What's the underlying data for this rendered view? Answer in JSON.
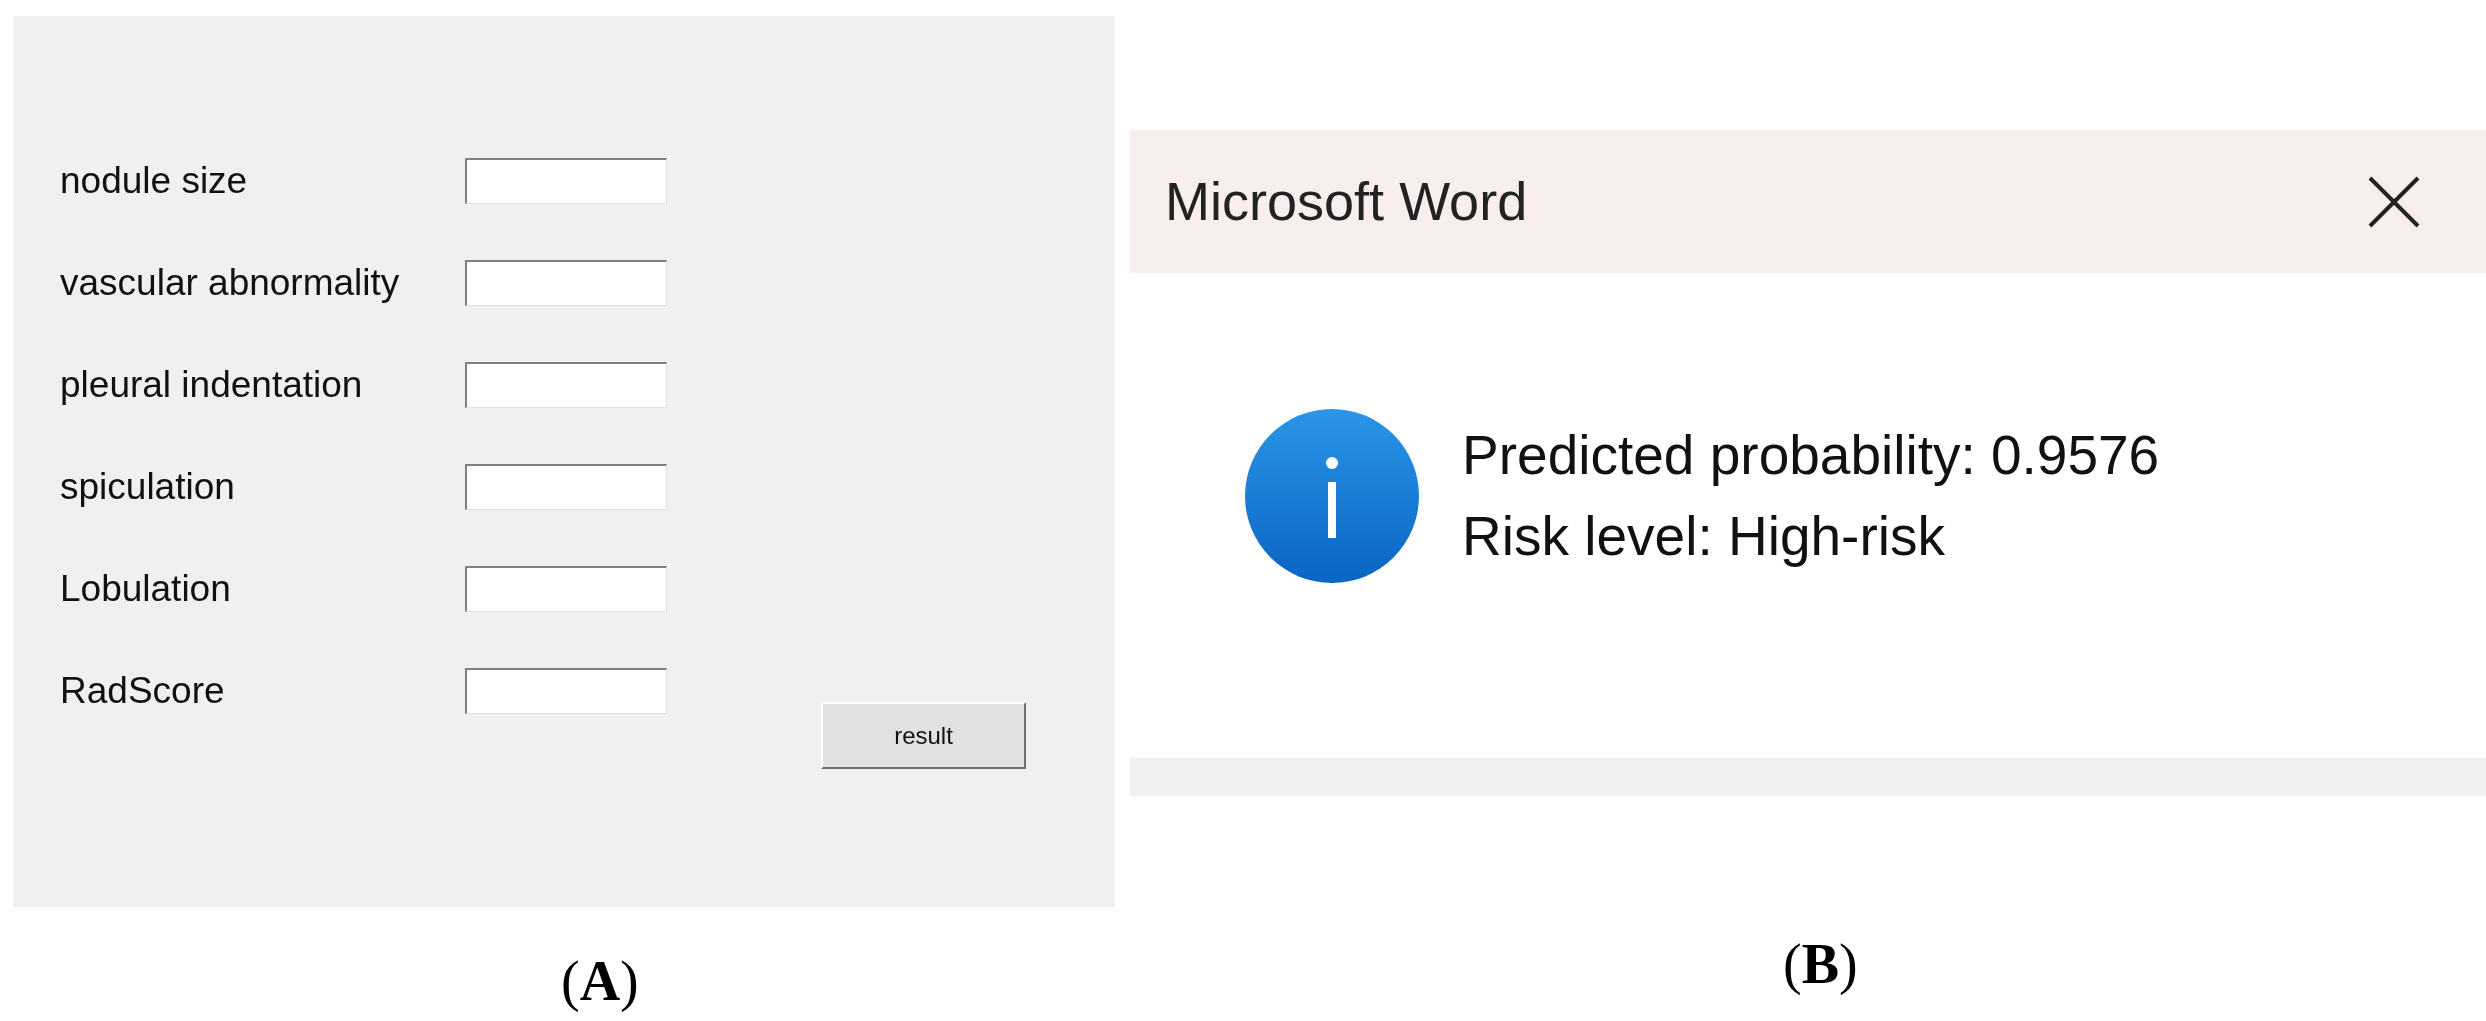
{
  "panel_a": {
    "fields": [
      {
        "label": "nodule size"
      },
      {
        "label": "vascular abnormality"
      },
      {
        "label": "pleural indentation"
      },
      {
        "label": "spiculation"
      },
      {
        "label": "Lobulation"
      },
      {
        "label": "RadScore"
      }
    ],
    "button": "result",
    "caption": "(**A**)"
  },
  "panel_b": {
    "window": {
      "title": "Microsoft Word"
    },
    "message": [
      "Predicted probability: 0.9576",
      "Risk level: High-risk"
    ],
    "caption": "(**B**)"
  }
}
